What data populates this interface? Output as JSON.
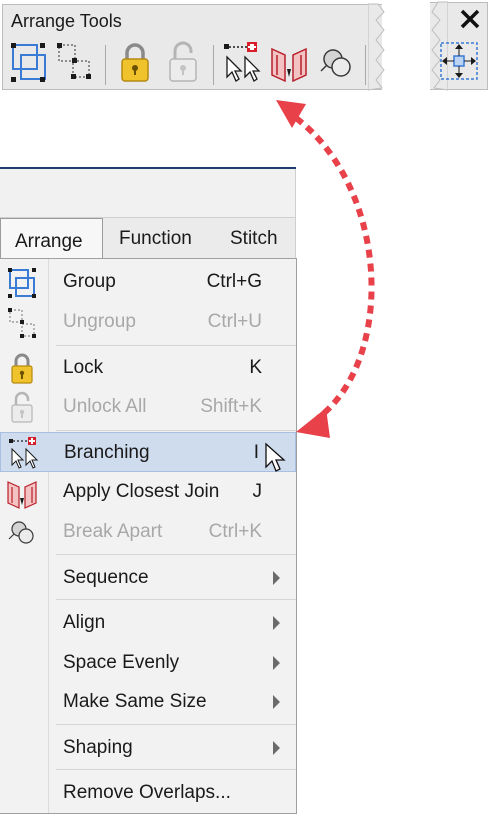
{
  "toolbar": {
    "title": "Arrange Tools",
    "tools": [
      {
        "icon": "group-icon"
      },
      {
        "icon": "ungroup-icon"
      },
      {
        "icon": "lock-icon"
      },
      {
        "icon": "unlock-icon"
      },
      {
        "icon": "branching-icon"
      },
      {
        "icon": "apply-closest-join-icon"
      },
      {
        "icon": "break-apart-icon"
      }
    ]
  },
  "toolbar_extra": {
    "close_icon": "close-icon",
    "tool_icon": "center-align-icon"
  },
  "menubar": {
    "tabs": [
      {
        "label": "Arrange",
        "active": true
      },
      {
        "label": "Function",
        "active": false
      },
      {
        "label": "Stitch",
        "active": false
      }
    ]
  },
  "menu": {
    "items": [
      {
        "label": "Group",
        "shortcut": "Ctrl+G",
        "enabled": true,
        "icon": "group-icon"
      },
      {
        "label": "Ungroup",
        "shortcut": "Ctrl+U",
        "enabled": false,
        "icon": "ungroup-icon"
      },
      {
        "label": "Lock",
        "shortcut": "K",
        "enabled": true,
        "icon": "lock-icon"
      },
      {
        "label": "Unlock All",
        "shortcut": "Shift+K",
        "enabled": false,
        "icon": "unlock-icon"
      },
      {
        "label": "Branching",
        "shortcut": "I",
        "enabled": true,
        "highlighted": true,
        "icon": "branching-icon"
      },
      {
        "label": "Apply Closest Join",
        "shortcut": "J",
        "enabled": true,
        "icon": "apply-closest-join-icon"
      },
      {
        "label": "Break Apart",
        "shortcut": "Ctrl+K",
        "enabled": false,
        "icon": "break-apart-icon"
      },
      {
        "label": "Sequence",
        "submenu": true
      },
      {
        "label": "Align",
        "submenu": true
      },
      {
        "label": "Space Evenly",
        "submenu": true
      },
      {
        "label": "Make Same Size",
        "submenu": true
      },
      {
        "label": "Shaping",
        "submenu": true
      },
      {
        "label": "Remove Overlaps..."
      }
    ]
  },
  "colors": {
    "highlight": "#cfdcee",
    "arrow": "#e8414a",
    "disabled_text": "#a8a8a8"
  }
}
